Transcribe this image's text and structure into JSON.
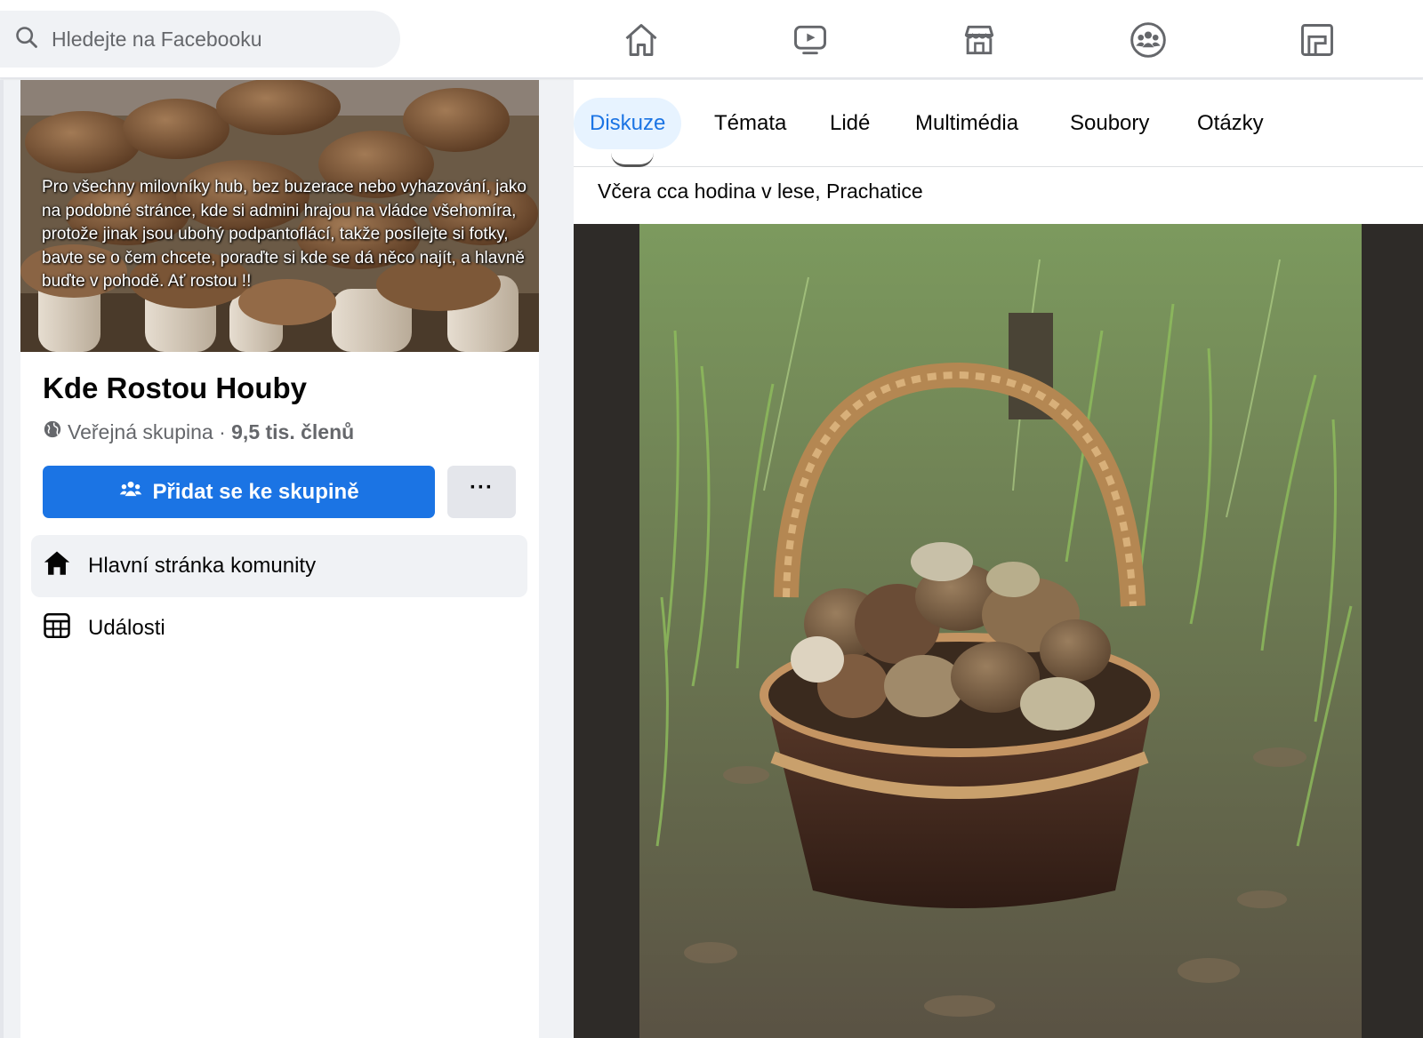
{
  "search": {
    "placeholder": "Hledejte na Facebooku",
    "icon": "search-icon"
  },
  "topnav": [
    {
      "name": "home",
      "icon": "home-icon"
    },
    {
      "name": "watch",
      "icon": "video-icon"
    },
    {
      "name": "marketplace",
      "icon": "marketplace-icon"
    },
    {
      "name": "groups",
      "icon": "groups-icon"
    },
    {
      "name": "gaming",
      "icon": "gaming-icon"
    }
  ],
  "group": {
    "cover_text": "Pro všechny milovníky hub, bez buzerace nebo vyhazování, jako na podobné stránce, kde si admini hrajou na vládce všehomíra, protože jinak jsou ubohý podpantoflácí, takže posílejte si fotky, bavte se o čem chcete, poraďte si kde se dá něco najít, a hlavně buďte v pohodě. Ať rostou !!",
    "name": "Kde Rostou Houby",
    "privacy": "Veřejná skupina",
    "separator": " · ",
    "members": "9,5 tis. členů",
    "join_label": "Přidat se ke skupině",
    "more_label": "···"
  },
  "sidebar": {
    "items": [
      {
        "label": "Hlavní stránka komunity",
        "icon": "home-filled-icon",
        "active": true
      },
      {
        "label": "Události",
        "icon": "calendar-icon",
        "active": false
      }
    ]
  },
  "tabs": [
    {
      "label": "Diskuze",
      "active": true
    },
    {
      "label": "Témata",
      "active": false
    },
    {
      "label": "Lidé",
      "active": false
    },
    {
      "label": "Multimédia",
      "active": false
    },
    {
      "label": "Soubory",
      "active": false
    },
    {
      "label": "Otázky",
      "active": false
    }
  ],
  "post": {
    "text": "Včera cca hodina v lese, Prachatice"
  },
  "colors": {
    "accent": "#1b74e4",
    "active_tab_bg": "#e7f3ff",
    "secondary_text": "#65676b"
  }
}
